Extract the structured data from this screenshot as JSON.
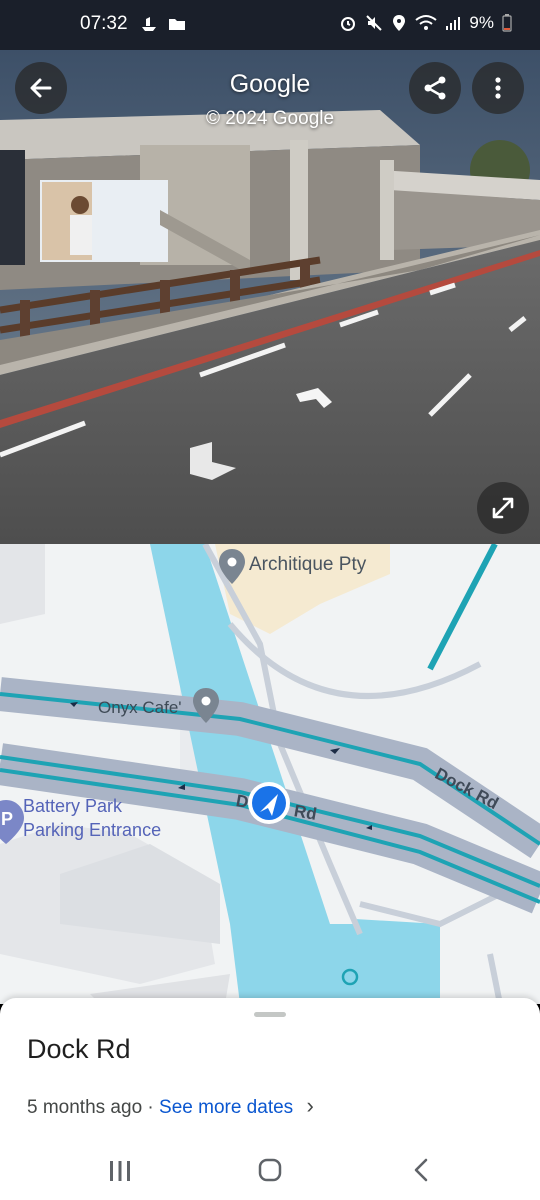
{
  "status_bar": {
    "time": "07:32",
    "battery": "9%"
  },
  "street_view": {
    "title": "Google",
    "copyright": "© 2024 Google",
    "icons": [
      "back-arrow-icon",
      "share-icon",
      "more-vert-icon",
      "expand-icon"
    ]
  },
  "map": {
    "labels": {
      "architique": "Architique Pty",
      "onyx": "Onyx Cafe'",
      "battery_park_line1": "Battery Park",
      "battery_park_line2": "Parking Entrance",
      "dock_rd_right": "Dock Rd",
      "dock_rd_center_left": "D",
      "dock_rd_center_right": "Rd"
    },
    "colors": {
      "water": "#8dd6ea",
      "road": "#aab4c6",
      "rail": "#1ea3b4",
      "building": "#f5ead1"
    }
  },
  "sheet": {
    "title": "Dock Rd",
    "age": "5 months ago",
    "separator": "·",
    "see_more": "See more dates",
    "chevron": "›"
  },
  "nav": {
    "recents_icon": "recents-icon",
    "home_icon": "home-icon",
    "back_icon": "back-nav-icon"
  }
}
